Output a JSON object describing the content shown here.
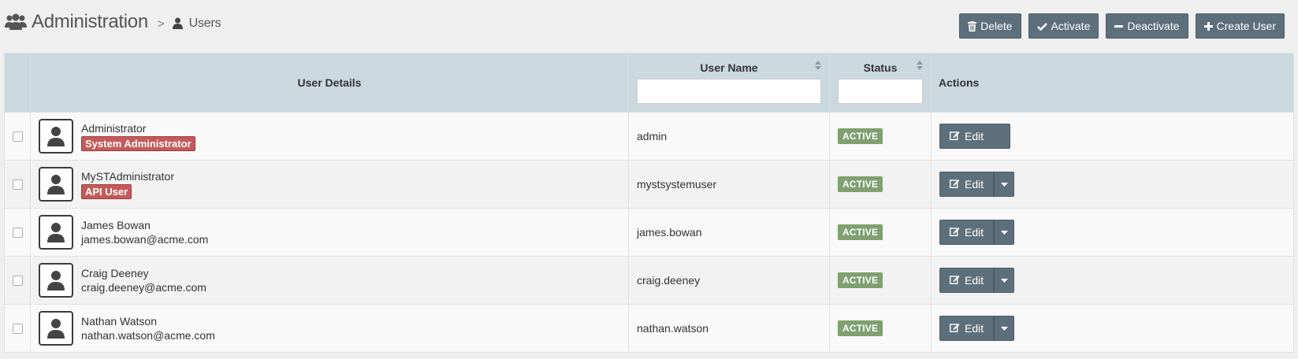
{
  "header": {
    "title": "Administration",
    "separator": ">",
    "crumb": "Users"
  },
  "toolbar": {
    "delete_label": "Delete",
    "activate_label": "Activate",
    "deactivate_label": "Deactivate",
    "create_label": "Create User"
  },
  "table": {
    "columns": {
      "details": "User Details",
      "username": "User Name",
      "status": "Status",
      "actions": "Actions"
    },
    "filters": {
      "username": "",
      "status": ""
    },
    "rows": [
      {
        "name": "Administrator",
        "role": "System Administrator",
        "email": "",
        "username": "admin",
        "status": "ACTIVE",
        "action": "Edit"
      },
      {
        "name": "MySTAdministrator",
        "role": "API User",
        "email": "",
        "username": "mystsystemuser",
        "status": "ACTIVE",
        "action": "Edit"
      },
      {
        "name": "James Bowan",
        "role": "",
        "email": "james.bowan@acme.com",
        "username": "james.bowan",
        "status": "ACTIVE",
        "action": "Edit"
      },
      {
        "name": "Craig Deeney",
        "role": "",
        "email": "craig.deeney@acme.com",
        "username": "craig.deeney",
        "status": "ACTIVE",
        "action": "Edit"
      },
      {
        "name": "Nathan Watson",
        "role": "",
        "email": "nathan.watson@acme.com",
        "username": "nathan.watson",
        "status": "ACTIVE",
        "action": "Edit"
      }
    ]
  },
  "colors": {
    "button": "#5d6f7b",
    "header_bg": "#cbd8de",
    "active_badge": "#7ea16f",
    "role_badge": "#c45a5a"
  },
  "icons": {
    "header": "users-icon",
    "crumb": "user-icon",
    "delete": "trash-icon",
    "activate": "check-icon",
    "deactivate": "minus-icon",
    "create": "plus-icon",
    "edit": "edit-icon",
    "avatar": "user-avatar-icon"
  }
}
